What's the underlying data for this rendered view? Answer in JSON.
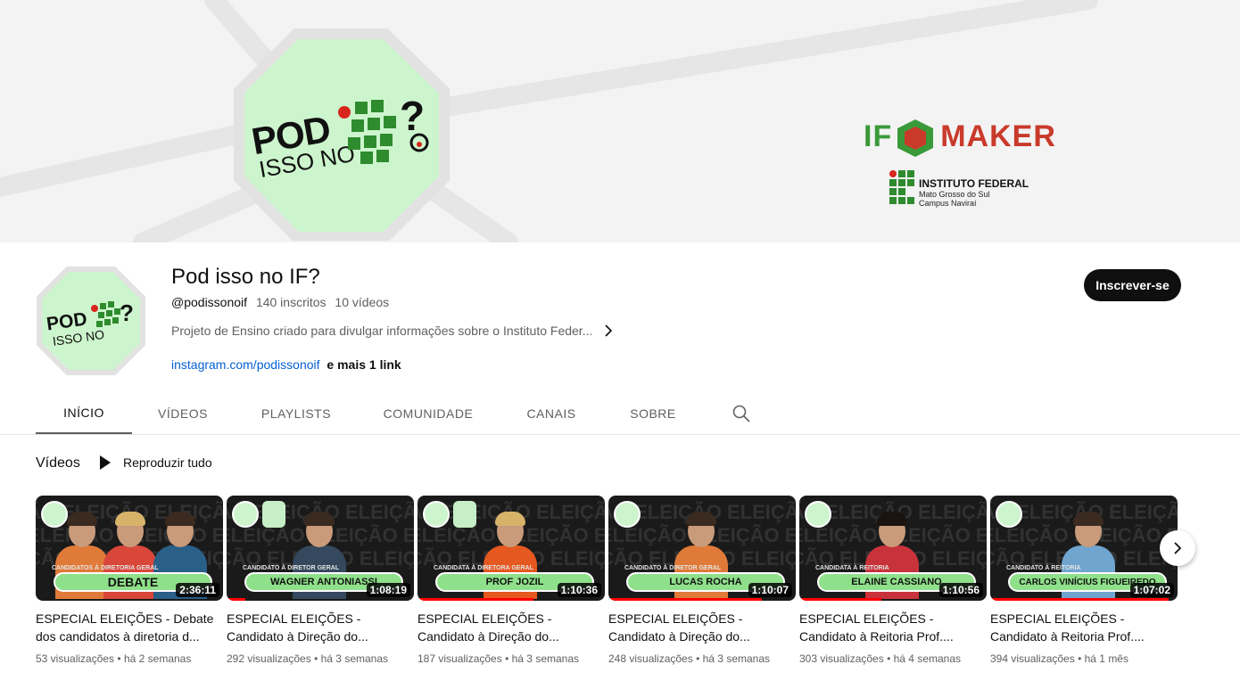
{
  "banner": {
    "logo_line1": "POD",
    "logo_line2": "ISSO NO",
    "partner_if": "IF",
    "partner_maker": "MAKER",
    "institute_title": "INSTITUTO FEDERAL",
    "institute_line1": "Mato Grosso do Sul",
    "institute_line2": "Campus Naviraí"
  },
  "channel": {
    "name": "Pod isso no IF?",
    "handle": "@podissonoif",
    "subscribers": "140 inscritos",
    "video_count": "10 vídeos",
    "description": "Projeto de Ensino criado para divulgar informações sobre o Instituto Feder...",
    "link_text": "instagram.com/podissonoif",
    "more_links": "e mais 1 link",
    "subscribe_label": "Inscrever-se"
  },
  "tabs": [
    {
      "label": "INÍCIO",
      "active": true
    },
    {
      "label": "VÍDEOS",
      "active": false
    },
    {
      "label": "PLAYLISTS",
      "active": false
    },
    {
      "label": "COMUNIDADE",
      "active": false
    },
    {
      "label": "CANAIS",
      "active": false
    },
    {
      "label": "SOBRE",
      "active": false
    }
  ],
  "section": {
    "title": "Vídeos",
    "play_all": "Reproduzir tudo"
  },
  "videos": [
    {
      "title": "ESPECIAL ELEIÇÕES - Debate dos candidatos à diretoria d...",
      "views": "53 visualizações",
      "age": "há 2 semanas",
      "duration": "2:36:11",
      "thumb_caption": "CANDIDATOS À DIRETORIA GERAL",
      "thumb_banner": "DEBATE",
      "watched_fraction": 0.0
    },
    {
      "title": "ESPECIAL ELEIÇÕES - Candidato à Direção do...",
      "views": "292 visualizações",
      "age": "há 3 semanas",
      "duration": "1:08:19",
      "thumb_caption": "CANDIDATO À DIRETOR GERAL",
      "thumb_banner": "WAGNER ANTONIASSI",
      "watched_fraction": 0.1
    },
    {
      "title": "ESPECIAL ELEIÇÕES - Candidato à Direção do...",
      "views": "187 visualizações",
      "age": "há 3 semanas",
      "duration": "1:10:36",
      "thumb_caption": "CANDIDATA À DIRETORA GERAL",
      "thumb_banner": "PROF JOZIL",
      "watched_fraction": 0.62
    },
    {
      "title": "ESPECIAL ELEIÇÕES - Candidato à Direção do...",
      "views": "248 visualizações",
      "age": "há 3 semanas",
      "duration": "1:10:07",
      "thumb_caption": "CANDIDATO À DIRETOR GERAL",
      "thumb_banner": "LUCAS ROCHA",
      "watched_fraction": 0.82
    },
    {
      "title": "ESPECIAL ELEIÇÕES - Candidato à Reitoria Prof....",
      "views": "303 visualizações",
      "age": "há 4 semanas",
      "duration": "1:10:56",
      "thumb_caption": "CANDIDATA À REITORIA",
      "thumb_banner": "ELAINE CASSIANO",
      "watched_fraction": 0.44
    },
    {
      "title": "ESPECIAL ELEIÇÕES - Candidato à Reitoria Prof....",
      "views": "394 visualizações",
      "age": "há 1 mês",
      "duration": "1:07:02",
      "thumb_caption": "CANDIDATO À REITORIA",
      "thumb_banner": "CARLOS VINÍCIUS FIGUEIREDO",
      "watched_fraction": 0.95
    }
  ],
  "meta_separator": "•",
  "colors": {
    "accent_red": "#ff0000",
    "link_blue": "#065fd4",
    "logo_green": "#cdf5cd",
    "banner_green": "#8fe08a"
  },
  "icons": {
    "search": "search-icon",
    "next": "chevron-right-icon",
    "play": "play-icon"
  }
}
